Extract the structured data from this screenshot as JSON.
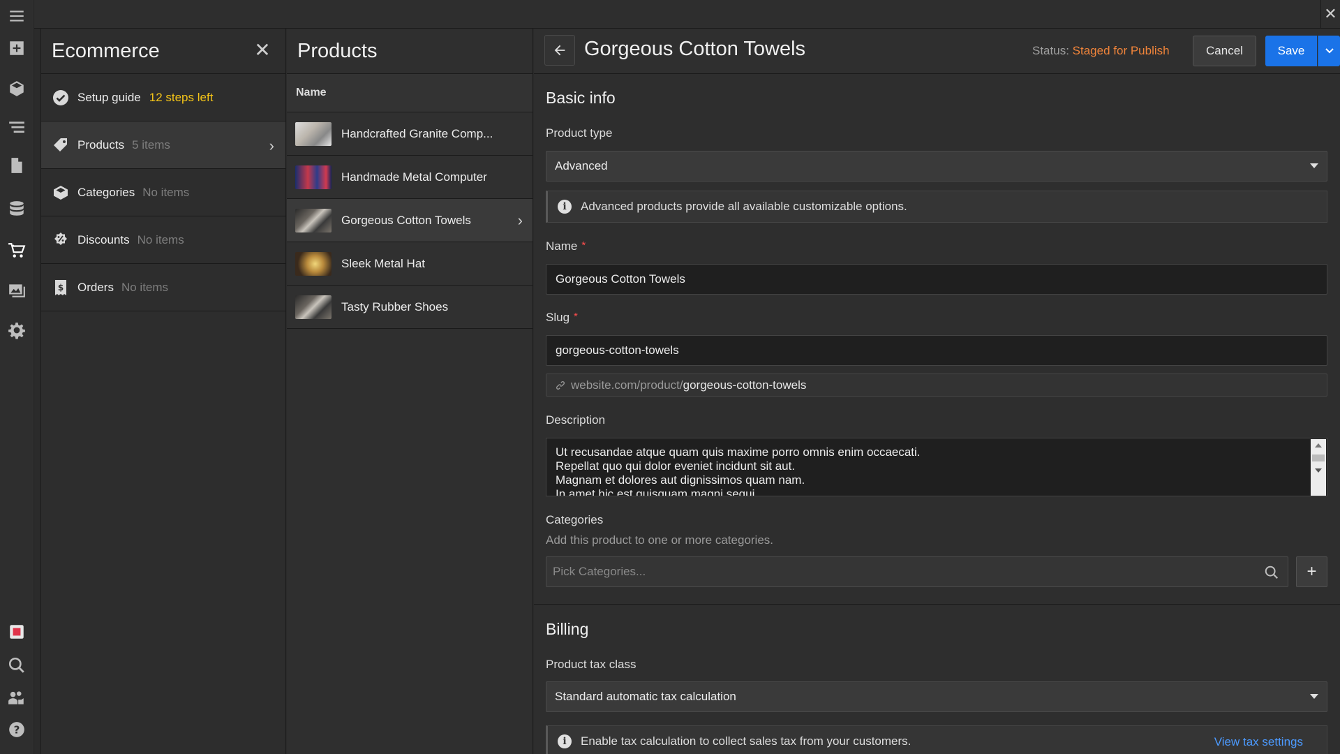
{
  "window": {
    "close_glyph": "✕"
  },
  "rail": {
    "items": [
      {
        "icon": "menu-icon"
      },
      {
        "icon": "add-icon"
      },
      {
        "icon": "box-icon"
      },
      {
        "icon": "navigator-icon"
      },
      {
        "icon": "pages-icon"
      },
      {
        "icon": "cms-icon"
      },
      {
        "icon": "cart-icon"
      },
      {
        "icon": "assets-icon"
      },
      {
        "icon": "settings-icon"
      },
      {
        "icon": "record-icon"
      },
      {
        "icon": "search-icon"
      },
      {
        "icon": "users-icon"
      },
      {
        "icon": "help-icon"
      }
    ]
  },
  "ecommerce": {
    "title": "Ecommerce",
    "close": "✕",
    "setup": {
      "label": "Setup guide",
      "steps": "12 steps left"
    },
    "items": [
      {
        "label": "Products",
        "count": "5 items"
      },
      {
        "label": "Categories",
        "count": "No items"
      },
      {
        "label": "Discounts",
        "count": "No items"
      },
      {
        "label": "Orders",
        "count": "No items"
      }
    ]
  },
  "products": {
    "title": "Products",
    "column": "Name",
    "rows": [
      {
        "name": "Handcrafted Granite Comp..."
      },
      {
        "name": "Handmade Metal Computer"
      },
      {
        "name": "Gorgeous Cotton Towels"
      },
      {
        "name": "Sleek Metal Hat"
      },
      {
        "name": "Tasty Rubber Shoes"
      }
    ]
  },
  "editor": {
    "title": "Gorgeous Cotton Towels",
    "status_label": "Status:",
    "status_value": "Staged for Publish",
    "cancel": "Cancel",
    "save": "Save",
    "basic_info": "Basic info",
    "product_type_label": "Product type",
    "product_type_value": "Advanced",
    "product_type_info": "Advanced products provide all available customizable options.",
    "name_label": "Name",
    "name_value": "Gorgeous Cotton Towels",
    "slug_label": "Slug",
    "slug_value": "gorgeous-cotton-towels",
    "url_prefix": "website.com/product/",
    "url_slug": "gorgeous-cotton-towels",
    "required_mark": "*",
    "description_label": "Description",
    "description_lines": [
      "Ut recusandae atque quam quis maxime porro omnis enim occaecati.",
      "Repellat quo qui dolor eveniet incidunt sit aut.",
      "Magnam et dolores aut dignissimos quam nam.",
      "In amet hic est quisquam magni sequi."
    ],
    "categories_label": "Categories",
    "categories_hint": "Add this product to one or more categories.",
    "categories_placeholder": "Pick Categories...",
    "add_glyph": "+",
    "billing": "Billing",
    "tax_class_label": "Product tax class",
    "tax_class_value": "Standard automatic tax calculation",
    "tax_info": "Enable tax calculation to collect sales tax from your customers.",
    "tax_link": "View tax settings"
  },
  "colors": {
    "accent": "#1a73e8",
    "status": "#f0843a",
    "steps": "#f5c518",
    "link": "#4c9aff",
    "required": "#ff4d4d"
  }
}
